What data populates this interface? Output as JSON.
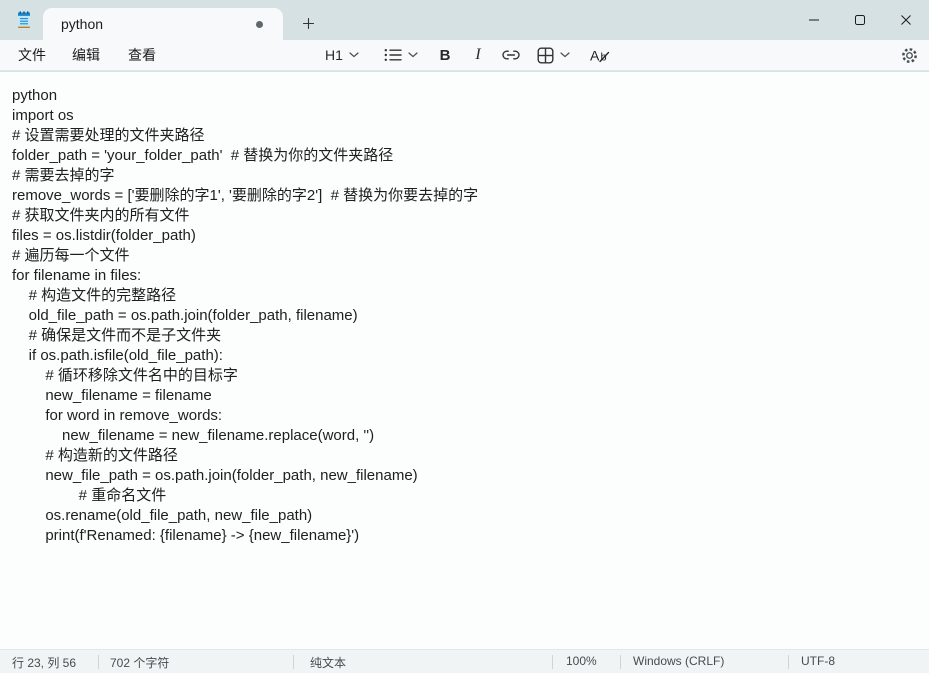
{
  "colors": {
    "titlebar_bg": "#d6e1e4",
    "surface_bg": "#f7f9fa",
    "editor_bg": "#fcfdfd",
    "statusbar_bg": "#f1f4f5",
    "divider": "#e2e7e8",
    "text_primary": "#1e1e1e",
    "text_secondary": "#454c4e",
    "notepad_icon_blue": "#1e88c9"
  },
  "titlebar": {
    "tab_title": "python",
    "icons": [
      "notepad-icon",
      "unsaved-dot-indicator",
      "new-tab-plus-icon",
      "minimize-icon",
      "maximize-icon",
      "close-icon"
    ]
  },
  "menubar": {
    "file_label": "文件",
    "edit_label": "编辑",
    "view_label": "查看"
  },
  "toolbar": {
    "heading_label": "H1",
    "bold_label": "B",
    "italic_label": "I",
    "icons": [
      "chevron-down-icon",
      "bullet-list-icon",
      "link-icon",
      "table-icon",
      "clear-formatting-icon",
      "gear-icon"
    ]
  },
  "editor": {
    "lines": [
      "python",
      "import os",
      "# 设置需要处理的文件夹路径",
      "folder_path = 'your_folder_path'  # 替换为你的文件夹路径",
      "# 需要去掉的字",
      "remove_words = ['要删除的字1', '要删除的字2']  # 替换为你要去掉的字",
      "# 获取文件夹内的所有文件",
      "files = os.listdir(folder_path)",
      "# 遍历每一个文件",
      "for filename in files:",
      "    # 构造文件的完整路径",
      "    old_file_path = os.path.join(folder_path, filename)",
      "    # 确保是文件而不是子文件夹",
      "    if os.path.isfile(old_file_path):",
      "        # 循环移除文件名中的目标字",
      "        new_filename = filename",
      "        for word in remove_words:",
      "            new_filename = new_filename.replace(word, '')",
      "        # 构造新的文件路径",
      "        new_file_path = os.path.join(folder_path, new_filename)",
      "                # 重命名文件",
      "        os.rename(old_file_path, new_file_path)",
      "        print(f'Renamed: {filename} -> {new_filename}')"
    ]
  },
  "statusbar": {
    "cursor_position": "行 23, 列 56",
    "char_count": "702 个字符",
    "doc_mode": "纯文本",
    "zoom_level": "100%",
    "line_ending": "Windows (CRLF)",
    "encoding": "UTF-8"
  }
}
